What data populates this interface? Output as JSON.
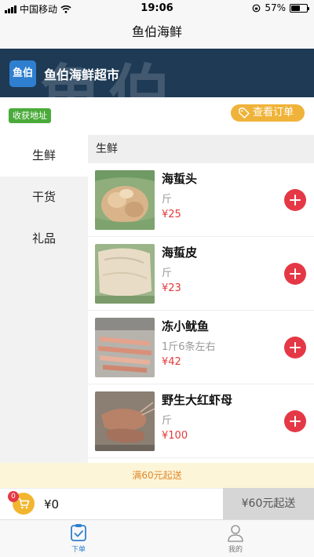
{
  "status_bar": {
    "carrier": "中国移动",
    "time": "19:06",
    "battery": "57%",
    "battery_level": 0.57
  },
  "nav": {
    "title": "鱼伯海鲜"
  },
  "banner": {
    "logo_text": "鱼伯",
    "shop_name": "鱼伯海鲜超市",
    "background_text": "鱼伯"
  },
  "info": {
    "address_tag": "收获地址",
    "orders_button": "查看订单"
  },
  "categories": [
    {
      "label": "生鲜",
      "active": true
    },
    {
      "label": "干货",
      "active": false
    },
    {
      "label": "礼品",
      "active": false
    }
  ],
  "section": {
    "title": "生鲜"
  },
  "products": [
    {
      "name": "海蜇头",
      "unit": "斤",
      "price": "¥25",
      "image": "jellyfish-head"
    },
    {
      "name": "海蜇皮",
      "unit": "斤",
      "price": "¥23",
      "image": "jellyfish-skin"
    },
    {
      "name": "冻小鱿鱼",
      "unit": "1斤6条左右",
      "price": "¥42",
      "image": "frozen-squid"
    },
    {
      "name": "野生大红虾母",
      "unit": "斤",
      "price": "¥100",
      "image": "red-shrimp"
    }
  ],
  "notice": {
    "min_order": "满60元起送"
  },
  "cart": {
    "count": "0",
    "total": "¥0",
    "checkout_label": "¥60元起送"
  },
  "tabs": [
    {
      "label": "下单",
      "icon": "order-clipboard-icon",
      "active": true
    },
    {
      "label": "我的",
      "icon": "user-icon",
      "active": false
    }
  ],
  "colors": {
    "accent_blue": "#2f7fd0",
    "add_red": "#e53846",
    "price_red": "#e23b3b",
    "order_yellow": "#f0b33a",
    "address_green": "#4aab3a",
    "banner_navy": "#1e3a55",
    "notice_bg": "#fdf5d8",
    "notice_text": "#e0892b"
  }
}
